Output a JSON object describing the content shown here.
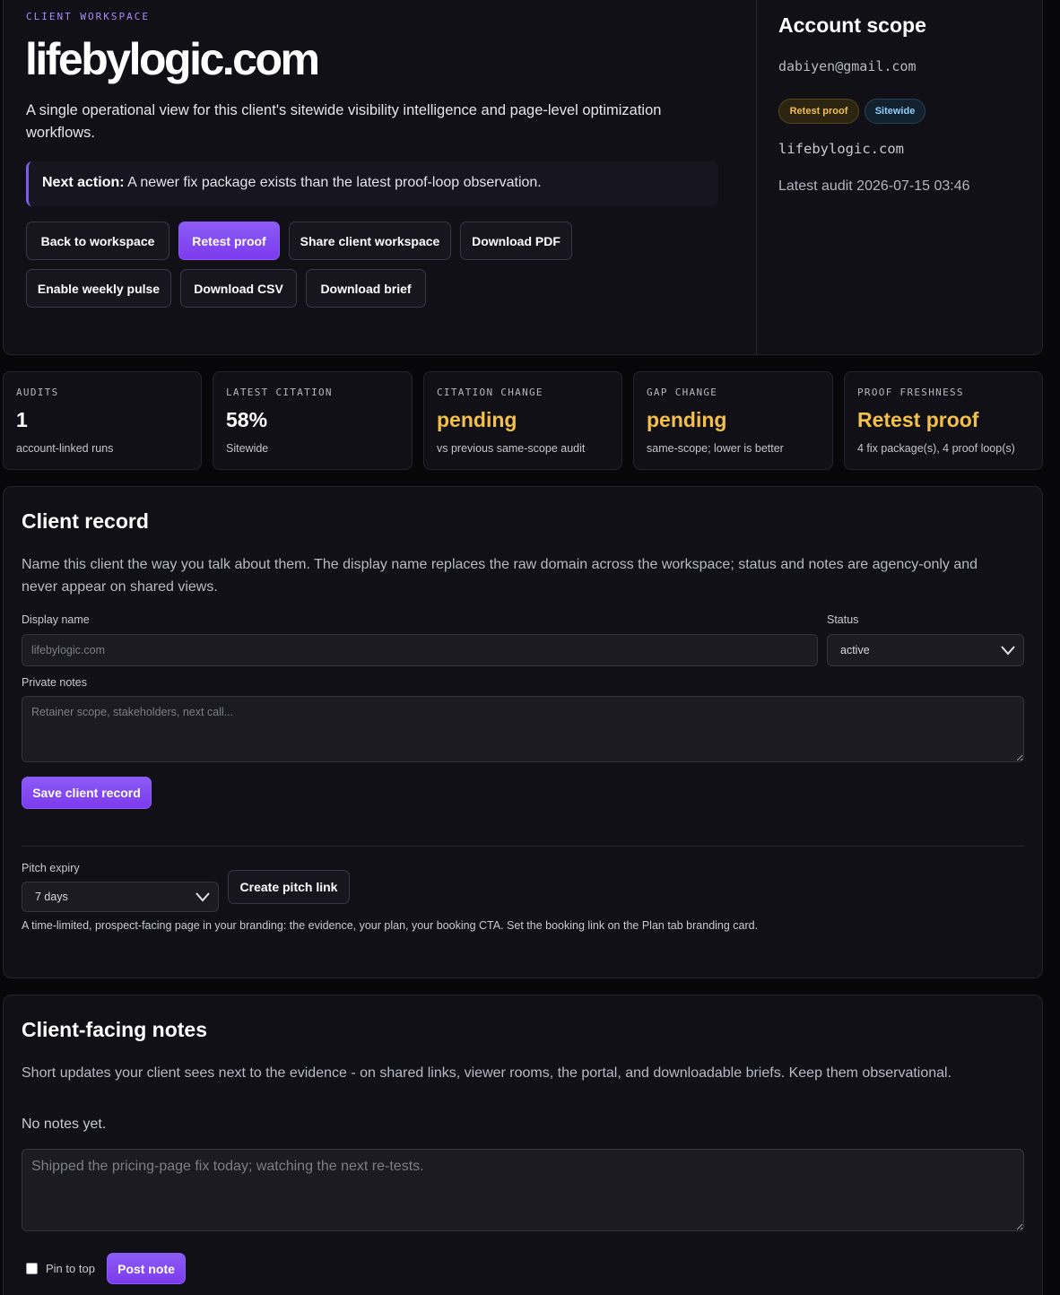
{
  "hero": {
    "eyebrow": "CLIENT WORKSPACE",
    "title": "lifebylogic.com",
    "description": "A single operational view for this client's sitewide visibility intelligence and page-level optimization workflows.",
    "next_action_label": "Next action:",
    "next_action_text": "A newer fix package exists than the latest proof-loop observation.",
    "buttons": {
      "back": "Back to workspace",
      "retest": "Retest proof",
      "share": "Share client workspace",
      "pdf": "Download PDF",
      "pulse": "Enable weekly pulse",
      "csv": "Download CSV",
      "brief": "Download brief"
    }
  },
  "account": {
    "title": "Account scope",
    "email": "dabiyen@gmail.com",
    "badges": {
      "status": "Retest proof",
      "scope": "Sitewide"
    },
    "domain": "lifebylogic.com",
    "latest_audit": "Latest audit 2026-07-15 03:46"
  },
  "stats": [
    {
      "label": "AUDITS",
      "value": "1",
      "sub": "account-linked runs"
    },
    {
      "label": "LATEST CITATION",
      "value": "58%",
      "sub": "Sitewide"
    },
    {
      "label": "CITATION CHANGE",
      "value": "pending",
      "sub": "vs previous same-scope audit"
    },
    {
      "label": "GAP CHANGE",
      "value": "pending",
      "sub": "same-scope; lower is better"
    },
    {
      "label": "PROOF FRESHNESS",
      "value": "Retest proof",
      "sub": "4 fix package(s), 4 proof loop(s)"
    }
  ],
  "client_record": {
    "title": "Client record",
    "description": "Name this client the way you talk about them. The display name replaces the raw domain across the workspace; status and notes are agency-only and never appear on shared views.",
    "display_name_label": "Display name",
    "display_name_placeholder": "lifebylogic.com",
    "status_label": "Status",
    "status_value": "active",
    "notes_label": "Private notes",
    "notes_placeholder": "Retainer scope, stakeholders, next call...",
    "save_label": "Save client record",
    "pitch_expiry_label": "Pitch expiry",
    "pitch_expiry_value": "7 days",
    "pitch_button": "Create pitch link",
    "pitch_hint": "A time-limited, prospect-facing page in your branding: the evidence, your plan, your booking CTA. Set the booking link on the Plan tab branding card."
  },
  "client_notes": {
    "title": "Client-facing notes",
    "description": "Short updates your client sees next to the evidence - on shared links, viewer rooms, the portal, and downloadable briefs. Keep them observational.",
    "empty": "No notes yet.",
    "placeholder": "Shipped the pricing-page fix today; watching the next re-tests.",
    "pin_label": "Pin to top",
    "post_label": "Post note"
  },
  "colors": {
    "accent": "#8b5cf6",
    "warn": "#f5c04a",
    "info": "#8fd0ff",
    "background": "#07070a",
    "panel": "#101016"
  }
}
